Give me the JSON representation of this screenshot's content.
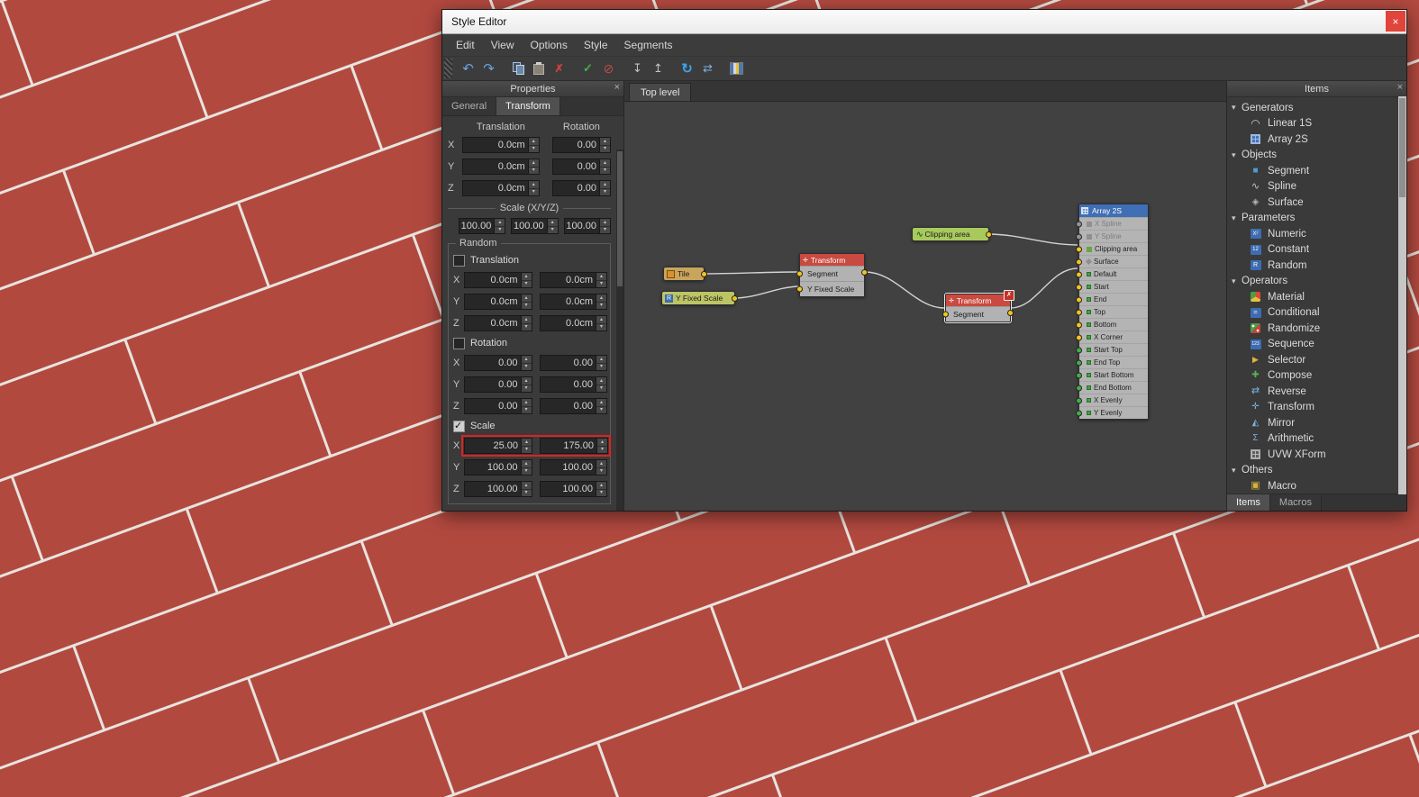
{
  "window": {
    "title": "Style Editor",
    "close": "×"
  },
  "menu": {
    "edit": "Edit",
    "view": "View",
    "options": "Options",
    "style": "Style",
    "segments": "Segments"
  },
  "toolbar": {
    "buttons": [
      "undo",
      "redo",
      "copy",
      "paste",
      "delete",
      "apply",
      "discard",
      "pack",
      "unpack",
      "refresh",
      "transfer",
      "library"
    ]
  },
  "properties": {
    "header": "Properties",
    "close": "×",
    "tab_general": "General",
    "tab_transform": "Transform",
    "col_translation": "Translation",
    "col_rotation": "Rotation",
    "ax": {
      "x": "X",
      "y": "Y",
      "z": "Z"
    },
    "translation": {
      "x": "0.0cm",
      "y": "0.0cm",
      "z": "0.0cm"
    },
    "rotation": {
      "x": "0.00",
      "y": "0.00",
      "z": "0.00"
    },
    "scale_label": "Scale (X/Y/Z)",
    "scale": {
      "x": "100.00",
      "y": "100.00",
      "z": "100.00"
    },
    "random": {
      "label": "Random",
      "translation": {
        "label": "Translation",
        "checked": false,
        "x": [
          "0.0cm",
          "0.0cm"
        ],
        "y": [
          "0.0cm",
          "0.0cm"
        ],
        "z": [
          "0.0cm",
          "0.0cm"
        ]
      },
      "rotation": {
        "label": "Rotation",
        "checked": false,
        "x": [
          "0.00",
          "0.00"
        ],
        "y": [
          "0.00",
          "0.00"
        ],
        "z": [
          "0.00",
          "0.00"
        ]
      },
      "scale": {
        "label": "Scale",
        "checked": true,
        "x_highlighted": true,
        "x": [
          "25.00",
          "175.00"
        ],
        "y": [
          "100.00",
          "100.00"
        ],
        "z": [
          "100.00",
          "100.00"
        ]
      }
    }
  },
  "canvas": {
    "tab": "Top level",
    "nodes": {
      "tile": {
        "label": "Tile"
      },
      "yfixed": {
        "label": "Y Fixed Scale"
      },
      "transform1": {
        "title": "Transform",
        "rows": [
          "Segment",
          "Y Fixed Scale"
        ]
      },
      "clipping": {
        "label": "Clipping area"
      },
      "transform2": {
        "title": "Transform",
        "rows": [
          "Segment"
        ],
        "selected": true,
        "delete_glyph": "✗"
      },
      "array": {
        "title": "Array 2S",
        "rows": [
          {
            "label": "X Spline",
            "port": "gray"
          },
          {
            "label": "Y Spline",
            "port": "gray"
          },
          {
            "label": "Clipping area",
            "port": "yellow"
          },
          {
            "label": "Surface",
            "port": "yellow"
          },
          {
            "label": "Default",
            "port": "yellow"
          },
          {
            "label": "Start",
            "port": "yellow"
          },
          {
            "label": "End",
            "port": "yellow"
          },
          {
            "label": "Top",
            "port": "yellow"
          },
          {
            "label": "Bottom",
            "port": "yellow"
          },
          {
            "label": "X Corner",
            "port": "yellow"
          },
          {
            "label": "Start Top",
            "port": "green"
          },
          {
            "label": "End Top",
            "port": "green"
          },
          {
            "label": "Start Bottom",
            "port": "green"
          },
          {
            "label": "End Bottom",
            "port": "green"
          },
          {
            "label": "X Evenly",
            "port": "green"
          },
          {
            "label": "Y Evenly",
            "port": "green"
          }
        ]
      }
    }
  },
  "items": {
    "header": "Items",
    "close": "×",
    "tab_items": "Items",
    "tab_macros": "Macros",
    "groups": [
      {
        "label": "Generators",
        "items": [
          {
            "label": "Linear 1S",
            "icon": "linear-1s-icon"
          },
          {
            "label": "Array 2S",
            "icon": "array-2s-icon"
          }
        ]
      },
      {
        "label": "Objects",
        "items": [
          {
            "label": "Segment",
            "icon": "segment-icon"
          },
          {
            "label": "Spline",
            "icon": "spline-icon"
          },
          {
            "label": "Surface",
            "icon": "surface-icon"
          }
        ]
      },
      {
        "label": "Parameters",
        "items": [
          {
            "label": "Numeric",
            "icon": "numeric-icon"
          },
          {
            "label": "Constant",
            "icon": "constant-icon"
          },
          {
            "label": "Random",
            "icon": "random-icon"
          }
        ]
      },
      {
        "label": "Operators",
        "items": [
          {
            "label": "Material",
            "icon": "material-icon"
          },
          {
            "label": "Conditional",
            "icon": "conditional-icon"
          },
          {
            "label": "Randomize",
            "icon": "randomize-icon"
          },
          {
            "label": "Sequence",
            "icon": "sequence-icon"
          },
          {
            "label": "Selector",
            "icon": "selector-icon"
          },
          {
            "label": "Compose",
            "icon": "compose-icon"
          },
          {
            "label": "Reverse",
            "icon": "reverse-icon"
          },
          {
            "label": "Transform",
            "icon": "transform-icon"
          },
          {
            "label": "Mirror",
            "icon": "mirror-icon"
          },
          {
            "label": "Arithmetic",
            "icon": "arithmetic-icon"
          },
          {
            "label": "UVW XForm",
            "icon": "uvw-xform-icon"
          }
        ]
      },
      {
        "label": "Others",
        "items": [
          {
            "label": "Macro",
            "icon": "macro-icon"
          }
        ]
      }
    ]
  },
  "colors": {
    "brick": "#b2493f",
    "mortar": "#e7e4de",
    "panel_bg": "#3a3a3a",
    "canvas_bg": "#414141",
    "transform_header": "#c94a40",
    "array_header": "#3f6fb4",
    "tile_node": "#c9a45c",
    "random_node": "#bcc465",
    "clipping_node": "#a8c95e",
    "port_yellow": "#f2c51d",
    "port_green": "#41ad41",
    "port_gray": "#929292",
    "highlight_red": "#e12020",
    "close_button": "#e0443a"
  }
}
